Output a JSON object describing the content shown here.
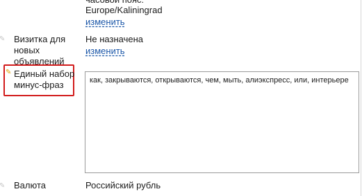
{
  "timezone": {
    "label_partial": "часовой пояс:",
    "value": "Europe/Kaliningrad",
    "change_link": "изменить"
  },
  "card": {
    "label_line1": "Визитка для",
    "label_line2": "новых",
    "label_line3": "объявлений",
    "value": "Не назначена",
    "change_link": "изменить"
  },
  "minus_phrases": {
    "label_line1": "Единый набор",
    "label_line2": "минус-фраз",
    "text": "как, закрываются, открываются, чем, мыть, алиэкспресс, или, интерьере"
  },
  "currency": {
    "label": "Валюта",
    "value": "Российский рубль"
  },
  "colors": {
    "highlight": "#d21b1b",
    "link": "#1a56a8",
    "pin_active": "#e0a000"
  }
}
